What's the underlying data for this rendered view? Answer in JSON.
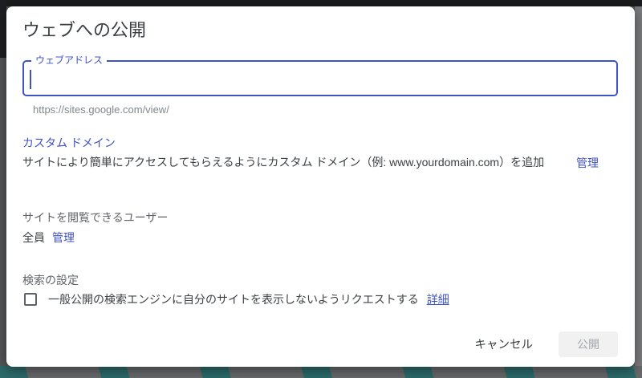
{
  "dialog": {
    "title": "ウェブへの公開",
    "web_address": {
      "label": "ウェブアドレス",
      "value": "",
      "helper": "https://sites.google.com/view/"
    },
    "custom_domain": {
      "link_label": "カスタム ドメイン",
      "description": "サイトにより簡単にアクセスしてもらえるようにカスタム ドメイン（例: www.yourdomain.com）を追加",
      "manage_label": "管理"
    },
    "viewers": {
      "label": "サイトを閲覧できるユーザー",
      "value": "全員",
      "manage_label": "管理"
    },
    "search": {
      "label": "検索の設定",
      "checkbox_label": "一般公開の検索エンジンに自分のサイトを表示しないようリクエストする",
      "checkbox_checked": false,
      "details_label": "詳細"
    },
    "actions": {
      "cancel_label": "キャンセル",
      "publish_label": "公開",
      "publish_enabled": false
    }
  },
  "colors": {
    "accent": "#3e52c5",
    "backdrop_teal": "#2c6b6a",
    "backdrop_gray": "#67696b"
  }
}
